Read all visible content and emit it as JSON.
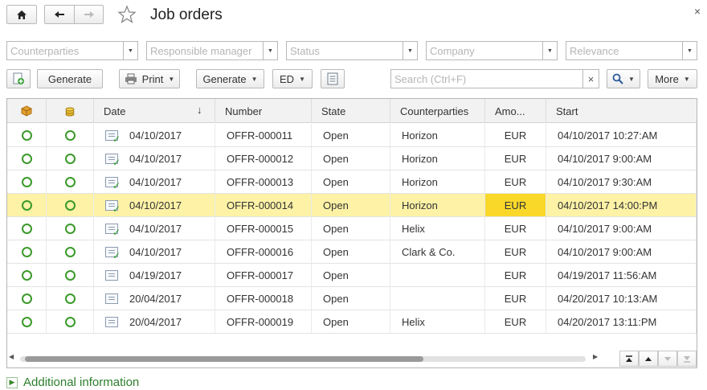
{
  "header": {
    "title": "Job orders",
    "close_label": "×"
  },
  "filters": {
    "counterparties": "Counterparties",
    "manager": "Responsible manager",
    "status": "Status",
    "company": "Company",
    "relevance": "Relevance"
  },
  "toolbar": {
    "generate_label": "Generate",
    "print_label": "Print",
    "generate2_label": "Generate",
    "ed_label": "ED",
    "search_placeholder": "Search (Ctrl+F)",
    "clear_label": "×",
    "more_label": "More"
  },
  "table": {
    "columns": [
      "Date",
      "Number",
      "State",
      "Counterparties",
      "Amo...",
      "Start"
    ],
    "sort_indicator": "↓",
    "rows": [
      {
        "date": "04/10/2017",
        "number": "OFFR-000011",
        "state": "Open",
        "counterparty": "Horizon",
        "amount": "EUR",
        "start": "04/10/2017 10:27:AM",
        "checked": true,
        "selected": false
      },
      {
        "date": "04/10/2017",
        "number": "OFFR-000012",
        "state": "Open",
        "counterparty": "Horizon",
        "amount": "EUR",
        "start": "04/10/2017 9:00:AM",
        "checked": true,
        "selected": false
      },
      {
        "date": "04/10/2017",
        "number": "OFFR-000013",
        "state": "Open",
        "counterparty": "Horizon",
        "amount": "EUR",
        "start": "04/10/2017 9:30:AM",
        "checked": true,
        "selected": false
      },
      {
        "date": "04/10/2017",
        "number": "OFFR-000014",
        "state": "Open",
        "counterparty": "Horizon",
        "amount": "EUR",
        "start": "04/10/2017 14:00:PM",
        "checked": true,
        "selected": true
      },
      {
        "date": "04/10/2017",
        "number": "OFFR-000015",
        "state": "Open",
        "counterparty": "Helix",
        "amount": "EUR",
        "start": "04/10/2017 9:00:AM",
        "checked": true,
        "selected": false
      },
      {
        "date": "04/10/2017",
        "number": "OFFR-000016",
        "state": "Open",
        "counterparty": "Clark & Co.",
        "amount": "EUR",
        "start": "04/10/2017 9:00:AM",
        "checked": true,
        "selected": false
      },
      {
        "date": "04/19/2017",
        "number": "OFFR-000017",
        "state": "Open",
        "counterparty": "",
        "amount": "EUR",
        "start": "04/19/2017 11:56:AM",
        "checked": false,
        "selected": false
      },
      {
        "date": "20/04/2017",
        "number": "OFFR-000018",
        "state": "Open",
        "counterparty": "",
        "amount": "EUR",
        "start": "04/20/2017 10:13:AM",
        "checked": false,
        "selected": false
      },
      {
        "date": "20/04/2017",
        "number": "OFFR-000019",
        "state": "Open",
        "counterparty": "Helix",
        "amount": "EUR",
        "start": "04/20/2017 13:11:PM",
        "checked": false,
        "selected": false
      }
    ]
  },
  "footer": {
    "additional_info": "Additional information"
  },
  "colors": {
    "selected_row": "#fdf2a6",
    "selected_cell": "#f9d82a",
    "status_green": "#3b9a2a",
    "link_green": "#2d7d2d"
  }
}
